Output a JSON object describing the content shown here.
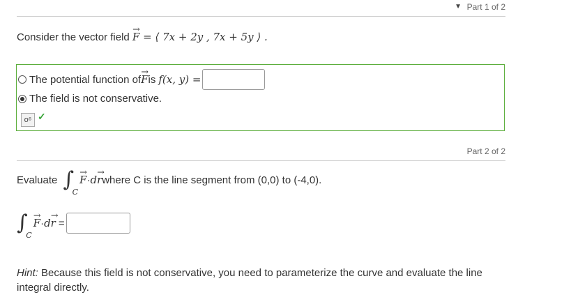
{
  "part1": {
    "label": "Part 1 of 2"
  },
  "question": {
    "intro": "Consider the vector field ",
    "field_name": "F",
    "field_expr": "= ⟨ 7x + 2y , 7x + 5y ⟩ ."
  },
  "options": [
    {
      "text_before": "The potential function of ",
      "field_name": "F",
      "text_after": " is ",
      "func": "f(x, y) =",
      "selected": false
    },
    {
      "text": "The field is not conservative.",
      "selected": true
    }
  ],
  "tools": {
    "key_icon": "key-icon",
    "check_icon": "checkmark-icon"
  },
  "part2": {
    "label": "Part 2 of 2",
    "evaluate": "Evaluate",
    "integral_symbol": "∫",
    "contour": "C",
    "integrand_field": "F",
    "dot": " · ",
    "integrand_d": "d",
    "integrand_r": "r",
    "where_text": " where C is the line segment from (0,0) to (-4,0).",
    "equals": "="
  },
  "hint": {
    "label": "Hint:",
    "text": " Because this field is not conservative, you need to parameterize the curve and evaluate the line integral directly."
  },
  "colors": {
    "success_border": "#5cae3c",
    "check": "#3aa53a"
  }
}
